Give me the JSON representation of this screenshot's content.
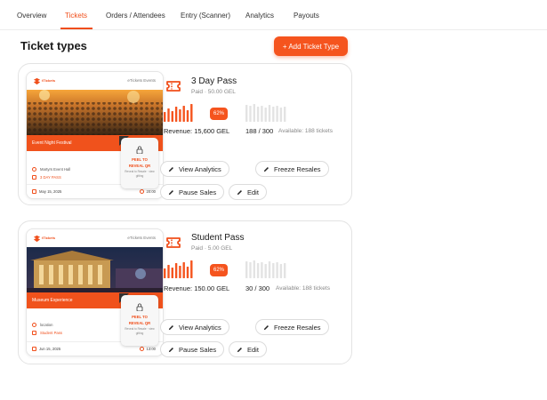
{
  "tabs": [
    {
      "label": "Overview",
      "active": false
    },
    {
      "label": "Tickets",
      "active": true
    },
    {
      "label": "Orders / Attendees",
      "active": false
    },
    {
      "label": "Entry (Scanner)",
      "active": false
    },
    {
      "label": "Analytics",
      "active": false
    },
    {
      "label": "Payouts",
      "active": false
    }
  ],
  "header": {
    "title": "Ticket types",
    "add_button": "+ Add Ticket Type"
  },
  "colors": {
    "accent": "#f5541e",
    "bar_inactive": "#e3e3e3"
  },
  "ticket_types": [
    {
      "name": "3 Day Pass",
      "price": "Paid · 50.00 GEL",
      "percent": "62%",
      "sold_fraction": 0.62,
      "revenue": "Revenue: 15,600 GEL",
      "sold": "188 / 300",
      "available": "Available: 188 tickets",
      "actions": {
        "analytics": "View Analytics",
        "freeze": "Freeze Resales",
        "pause": "Pause Sales",
        "edit": "Edit"
      },
      "preview": {
        "brand": "tTickets",
        "events_label": "eTickets Events",
        "event_name": "Event Night Festival",
        "venue": "Martyrs Event Hall",
        "extra": "3 DAY PASS",
        "date": "May 15, 2025",
        "time": "20:00",
        "peel_line1": "PEEL TO",
        "peel_line2": "REVEAL QR",
        "peel_line3": "Reveal to Resale · view gifting"
      }
    },
    {
      "name": "Student Pass",
      "price": "Paid · 5.00 GEL",
      "percent": "62%",
      "sold_fraction": 0.62,
      "revenue": "Revenue: 150.00 GEL",
      "sold": "30 / 300",
      "available": "Available: 188 tickets",
      "actions": {
        "analytics": "View Analytics",
        "freeze": "Freeze Resales",
        "pause": "Pause Sales",
        "edit": "Edit"
      },
      "preview": {
        "brand": "tTickets",
        "events_label": "eTickets Events",
        "event_name": "Museum Experience",
        "venue": "location",
        "extra": "Student Pass",
        "date": "Jun 15, 2025",
        "time": "13:00",
        "peel_line1": "PEEL TO",
        "peel_line2": "REVEAL QR",
        "peel_line3": "Reveal to Resale · view gifting"
      }
    }
  ]
}
